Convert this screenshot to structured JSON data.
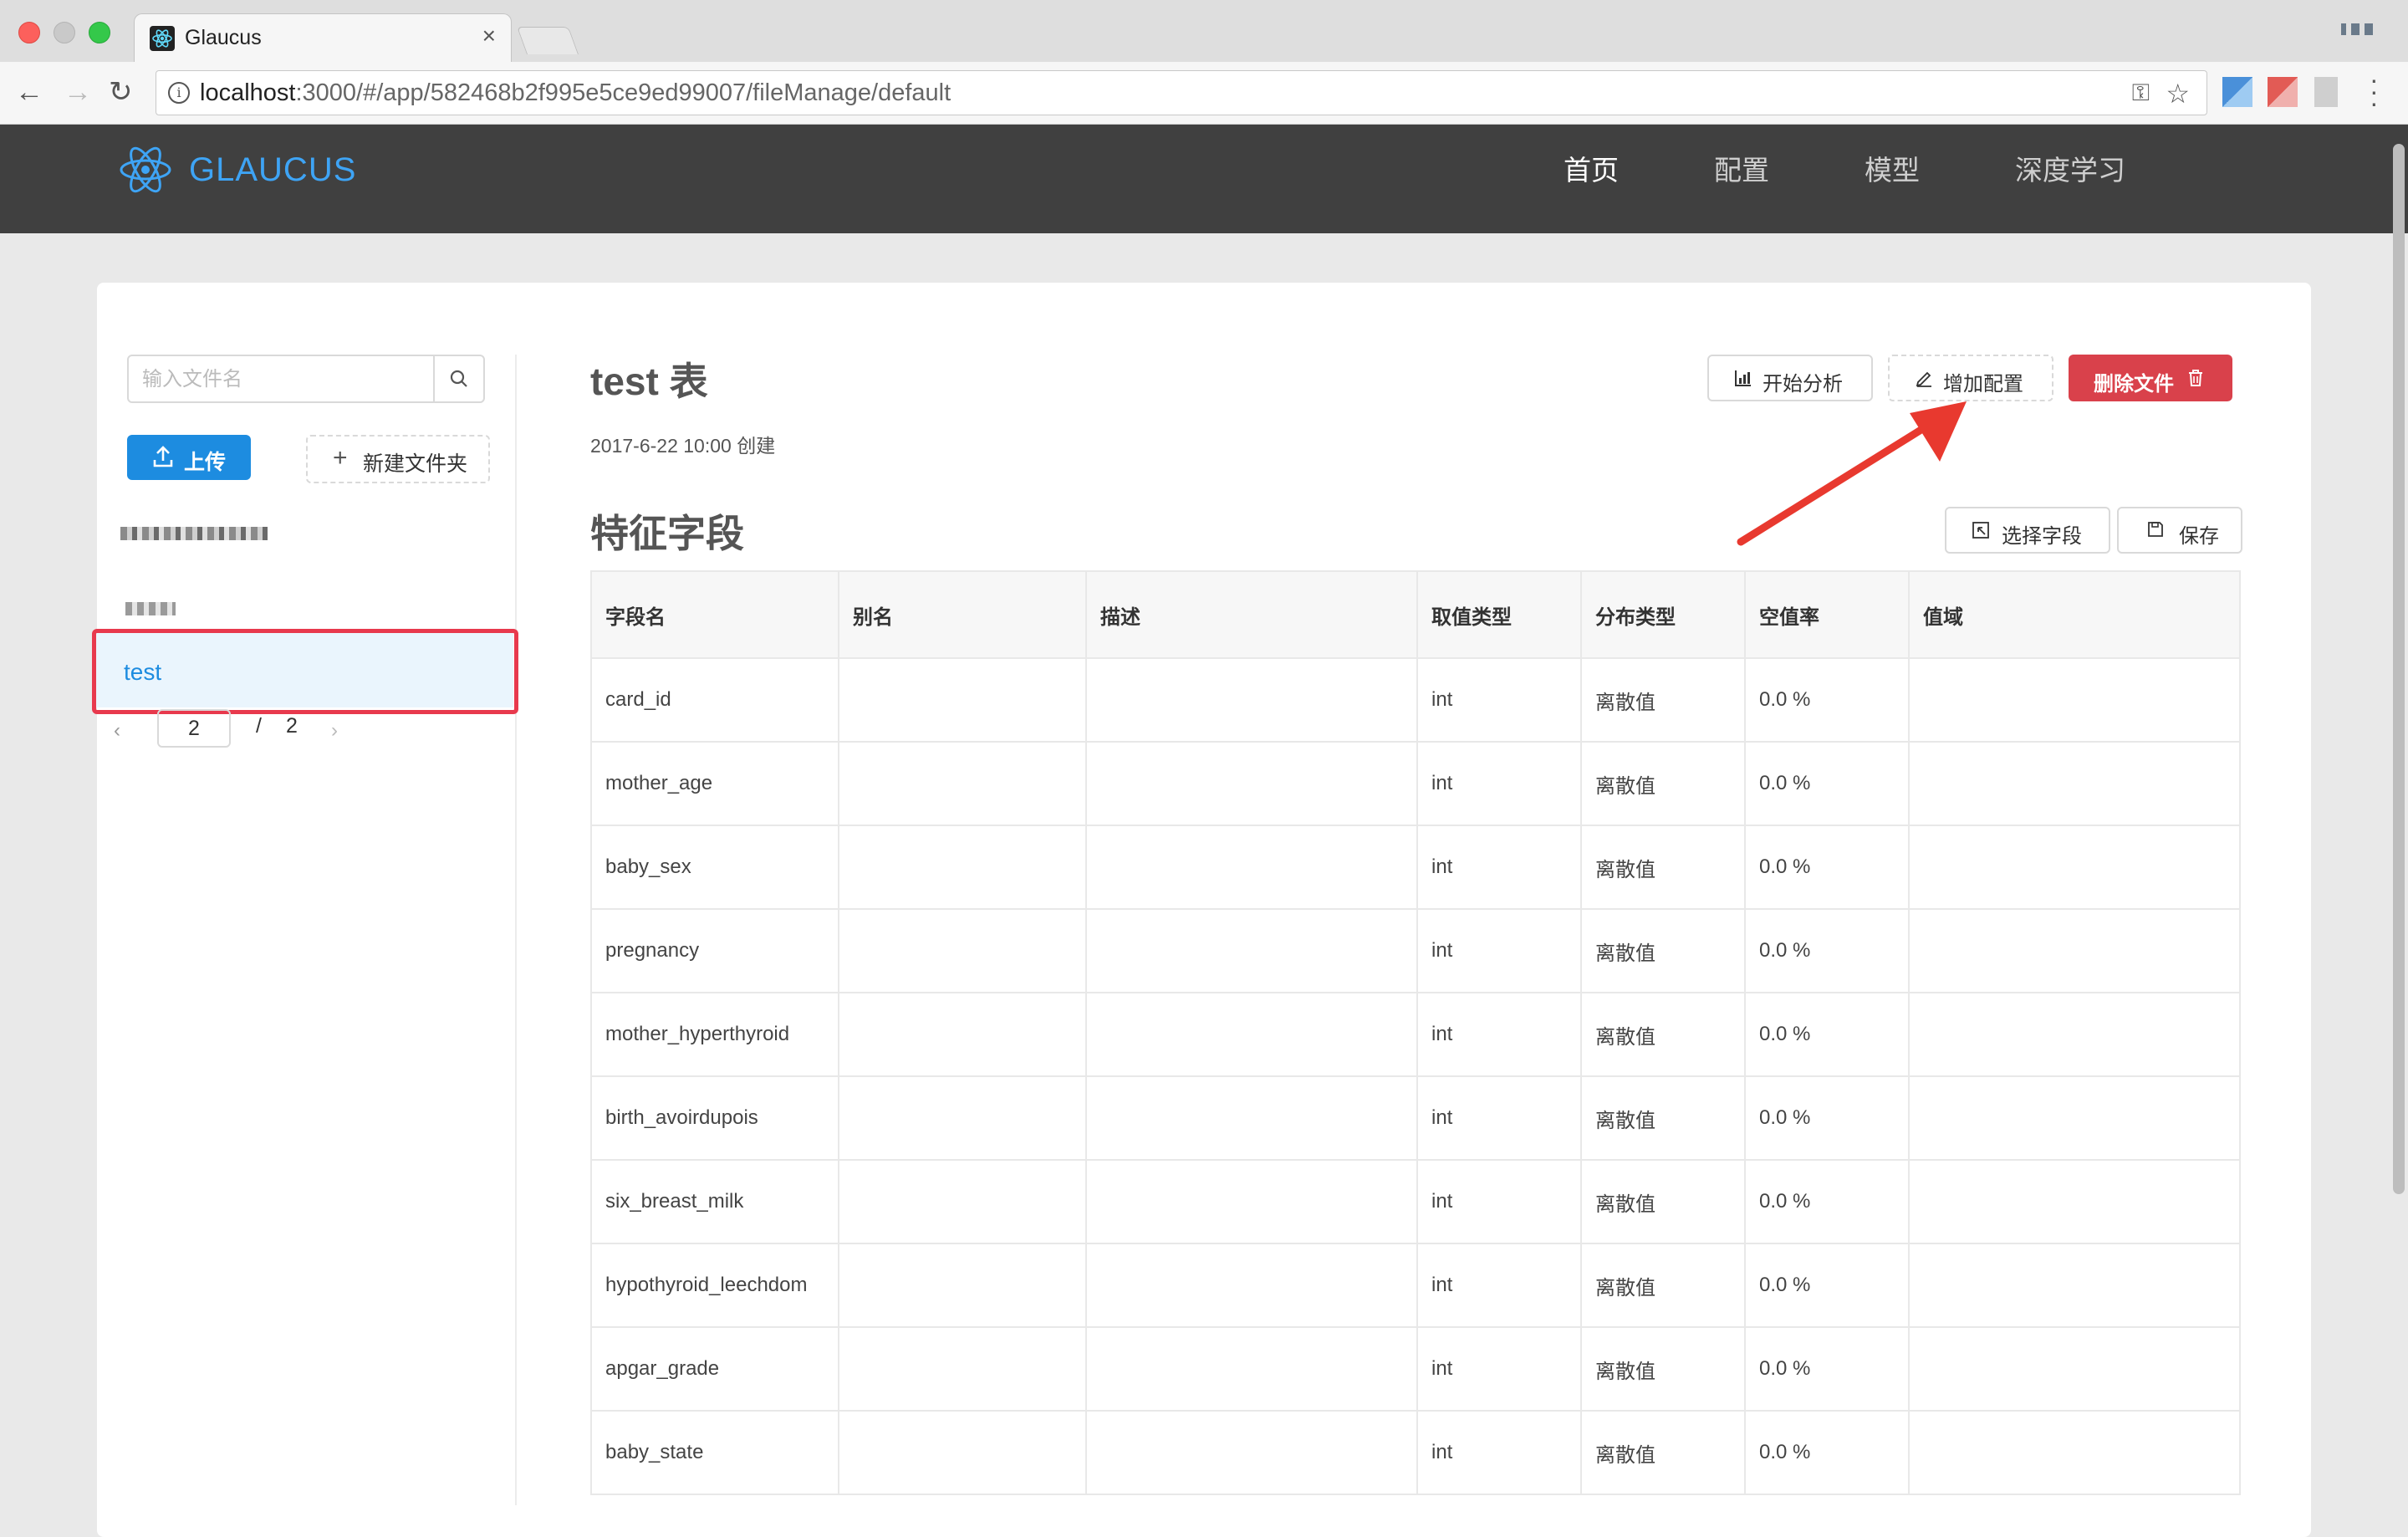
{
  "browser": {
    "tab_title": "Glaucus",
    "tab_close": "×",
    "url_host": "localhost",
    "url_rest": ":3000/#/app/582468b2f995e5ce9ed99007/fileManage/default"
  },
  "header": {
    "logo_text": "GLAUCUS",
    "nav": {
      "home": "首页",
      "config": "配置",
      "model": "模型",
      "deep_learning": "深度学习"
    }
  },
  "sidebar": {
    "search_placeholder": "输入文件名",
    "upload_label": "上传",
    "new_folder_label": "新建文件夹",
    "selected_file": "test",
    "pager": {
      "current": "2",
      "separator": "/",
      "total": "2"
    }
  },
  "main": {
    "title": "test 表",
    "created": "2017-6-22 10:00 创建",
    "buttons": {
      "analyze": "开始分析",
      "add_config": "增加配置",
      "delete_file": "删除文件",
      "select_fields": "选择字段",
      "save": "保存"
    },
    "section_title": "特征字段",
    "table": {
      "headers": [
        "字段名",
        "别名",
        "描述",
        "取值类型",
        "分布类型",
        "空值率",
        "值域"
      ],
      "rows": [
        [
          "card_id",
          "",
          "",
          "int",
          "离散值",
          "0.0 %",
          ""
        ],
        [
          "mother_age",
          "",
          "",
          "int",
          "离散值",
          "0.0 %",
          ""
        ],
        [
          "baby_sex",
          "",
          "",
          "int",
          "离散值",
          "0.0 %",
          ""
        ],
        [
          "pregnancy",
          "",
          "",
          "int",
          "离散值",
          "0.0 %",
          ""
        ],
        [
          "mother_hyperthyroid",
          "",
          "",
          "int",
          "离散值",
          "0.0 %",
          ""
        ],
        [
          "birth_avoirdupois",
          "",
          "",
          "int",
          "离散值",
          "0.0 %",
          ""
        ],
        [
          "six_breast_milk",
          "",
          "",
          "int",
          "离散值",
          "0.0 %",
          ""
        ],
        [
          "hypothyroid_leechdom",
          "",
          "",
          "int",
          "离散值",
          "0.0 %",
          ""
        ],
        [
          "apgar_grade",
          "",
          "",
          "int",
          "离散值",
          "0.0 %",
          ""
        ],
        [
          "baby_state",
          "",
          "",
          "int",
          "离散值",
          "0.0 %",
          ""
        ]
      ]
    }
  },
  "colors": {
    "primary": "#1d8ce0",
    "danger": "#d9414b",
    "header_bg": "#404040",
    "highlight": "#e8394d"
  }
}
